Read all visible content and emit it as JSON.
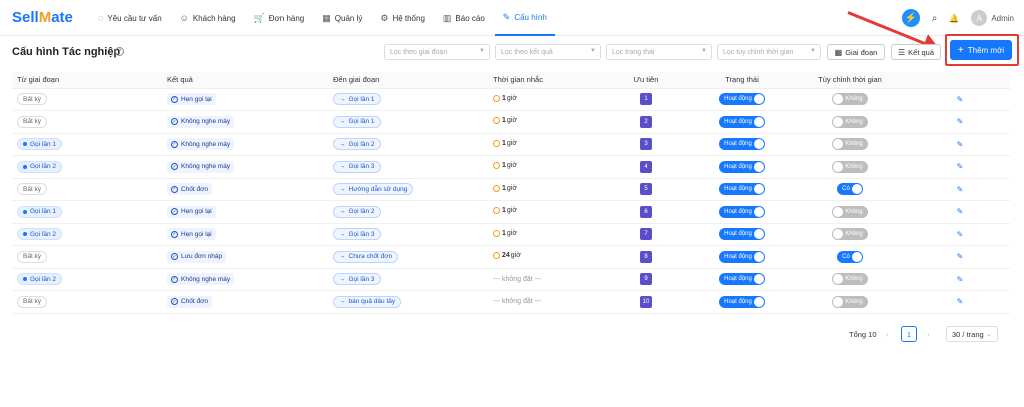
{
  "app": {
    "brand_a": "Sell",
    "brand_b": "M",
    "brand_c": "ate"
  },
  "nav": [
    {
      "icon": "◌",
      "label": "Yêu cầu tư vấn"
    },
    {
      "icon": "☺",
      "label": "Khách hàng"
    },
    {
      "icon": "🛒",
      "label": "Đơn hàng"
    },
    {
      "icon": "▦",
      "label": "Quản lý"
    },
    {
      "icon": "⚙",
      "label": "Hệ thống"
    },
    {
      "icon": "▥",
      "label": "Báo cáo"
    },
    {
      "icon": "✎",
      "label": "Cấu hình"
    }
  ],
  "topright": {
    "bolt": "⚡",
    "search": "⌕",
    "bell": "🔔",
    "avatar": "A",
    "user": "Admin"
  },
  "page": {
    "title": "Cấu hình Tác nghiệp",
    "help": "?",
    "filter_stage": "Lọc theo giai đoạn",
    "filter_result": "Lọc theo kết quả",
    "filter_status": "Lọc trạng thái",
    "filter_custom": "Lọc tùy chỉnh thời gian",
    "btn_stage": "Giai đoạn",
    "btn_result": "Kết quả",
    "btn_add": "Thêm mới",
    "btn_add_icon": "+"
  },
  "table": {
    "headers": [
      "Từ giai đoạn",
      "Kết quả",
      "Đến giai đoạn",
      "Thời gian nhắc",
      "Ưu tiên",
      "Trạng thái",
      "Tùy chỉnh thời gian",
      ""
    ],
    "rows": [
      {
        "from": "Bất kỳ",
        "from_blue": false,
        "result": "Hẹn gọi lại",
        "to": "Gọi lần 1",
        "hours": "1",
        "unit": "giờ",
        "priority": "1",
        "status": "Hoạt động",
        "custom": "Không",
        "custom_on": false
      },
      {
        "from": "Bất kỳ",
        "from_blue": false,
        "result": "Không nghe máy",
        "to": "Gọi lần 1",
        "hours": "1",
        "unit": "giờ",
        "priority": "2",
        "status": "Hoạt động",
        "custom": "Không",
        "custom_on": false
      },
      {
        "from": "Gọi lần 1",
        "from_blue": true,
        "result": "Không nghe máy",
        "to": "Gọi lần 2",
        "hours": "1",
        "unit": "giờ",
        "priority": "3",
        "status": "Hoạt động",
        "custom": "Không",
        "custom_on": false
      },
      {
        "from": "Gọi lần 2",
        "from_blue": true,
        "result": "Không nghe máy",
        "to": "Gọi lần 3",
        "hours": "1",
        "unit": "giờ",
        "priority": "4",
        "status": "Hoạt động",
        "custom": "Không",
        "custom_on": false
      },
      {
        "from": "Bất kỳ",
        "from_blue": false,
        "result": "Chốt đơn",
        "to": "Hướng dẫn sử dụng",
        "hours": "1",
        "unit": "giờ",
        "priority": "5",
        "status": "Hoạt động",
        "custom": "Có",
        "custom_on": true
      },
      {
        "from": "Gọi lần 1",
        "from_blue": true,
        "result": "Hẹn gọi lại",
        "to": "Gọi lần 2",
        "hours": "1",
        "unit": "giờ",
        "priority": "6",
        "status": "Hoạt động",
        "custom": "Không",
        "custom_on": false
      },
      {
        "from": "Gọi lần 2",
        "from_blue": true,
        "result": "Hẹn gọi lại",
        "to": "Gọi lần 3",
        "hours": "1",
        "unit": "giờ",
        "priority": "7",
        "status": "Hoạt động",
        "custom": "Không",
        "custom_on": false
      },
      {
        "from": "Bất kỳ",
        "from_blue": false,
        "result": "Lưu đơn nháp",
        "to": "Chưa chốt đơn",
        "hours": "24",
        "unit": "giờ",
        "priority": "8",
        "status": "Hoạt động",
        "custom": "Có",
        "custom_on": true
      },
      {
        "from": "Gọi lần 2",
        "from_blue": true,
        "result": "Không nghe máy",
        "to": "Gọi lần 3",
        "hours": "",
        "unit": "--- không đặt ---",
        "priority": "9",
        "status": "Hoạt động",
        "custom": "Không",
        "custom_on": false
      },
      {
        "from": "Bất kỳ",
        "from_blue": false,
        "result": "Chốt đơn",
        "to": "bán quả dâu tây",
        "hours": "",
        "unit": "--- không đặt ---",
        "priority": "10",
        "status": "Hoạt động",
        "custom": "Không",
        "custom_on": false
      }
    ]
  },
  "pager": {
    "total": "Tổng 10",
    "prev": "‹",
    "page": "1",
    "next": "›",
    "size": "30 / trang",
    "size_caret": "⌄"
  },
  "colors": {
    "primary": "#1677ff",
    "priority": "#5b4ec9",
    "annotation": "#e53935"
  }
}
